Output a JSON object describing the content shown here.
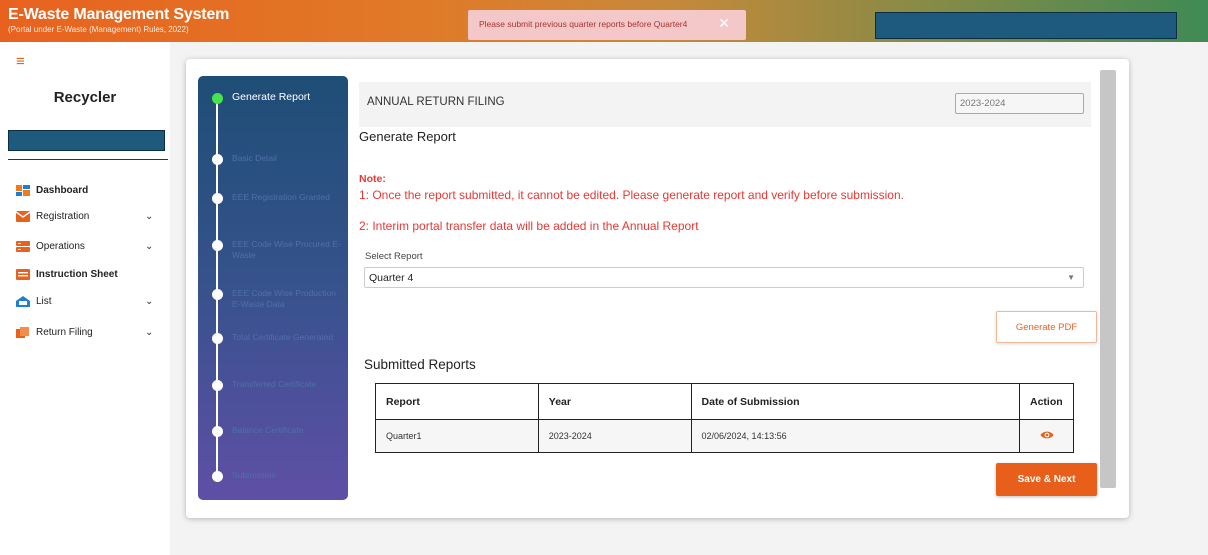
{
  "colors": {
    "accent": "#e8621f",
    "note_red": "#e53935",
    "active_step": "#47e34f",
    "stepper_top": "#1e4e76",
    "stepper_bottom": "#5f4fa6"
  },
  "header": {
    "title": "E-Waste Management System",
    "subtitle": "(Portal under E-Waste (Management) Rules, 2022)"
  },
  "toast": {
    "message": "Please submit previous quarter reports before Quarter4",
    "close": "✕"
  },
  "sidebar": {
    "menu_icon": "≡",
    "role": "Recycler",
    "items": [
      {
        "label": "Dashboard",
        "icon": "dashboard-icon",
        "bold": true,
        "has_chevron": false
      },
      {
        "label": "Registration",
        "icon": "mail-icon",
        "bold": false,
        "has_chevron": true
      },
      {
        "label": "Operations",
        "icon": "operations-icon",
        "bold": false,
        "has_chevron": true
      },
      {
        "label": "Instruction Sheet",
        "icon": "instruction-icon",
        "bold": true,
        "has_chevron": false
      },
      {
        "label": "List",
        "icon": "list-icon",
        "bold": false,
        "has_chevron": true
      },
      {
        "label": "Return Filing",
        "icon": "return-filing-icon",
        "bold": false,
        "has_chevron": true
      }
    ],
    "chevron": "⌄"
  },
  "stepper": {
    "steps": [
      {
        "label": "Generate Report",
        "active": true
      },
      {
        "label": "Basic Detail",
        "active": false
      },
      {
        "label": "EEE Registration Granted",
        "active": false
      },
      {
        "label": "EEE Code Wise Procured E-Waste",
        "active": false
      },
      {
        "label": "EEE Code Wise Production E-Waste Data",
        "active": false
      },
      {
        "label": "Total Certificate Generated",
        "active": false
      },
      {
        "label": "Transferred Certificate",
        "active": false
      },
      {
        "label": "Balance Certificate",
        "active": false
      },
      {
        "label": "Submission",
        "active": false
      }
    ]
  },
  "main": {
    "filing_title": "ANNUAL RETURN FILING",
    "year": "2023-2024",
    "section_title": "Generate Report",
    "note_label": "Note:",
    "note_lines": [
      "1: Once the report submitted, it cannot be edited. Please generate report and verify before submission.",
      "2: Interim portal transfer data will be added in the Annual Report"
    ],
    "select_label": "Select Report",
    "select_value": "Quarter 4",
    "generate_pdf": "Generate PDF",
    "submitted_title": "Submitted Reports",
    "table": {
      "columns": [
        "Report",
        "Year",
        "Date of Submission",
        "Action"
      ],
      "rows": [
        {
          "report": "Quarter1",
          "year": "2023-2024",
          "date": "02/06/2024, 14:13:56",
          "action_icon": "eye-icon"
        }
      ]
    },
    "save_next": "Save & Next"
  }
}
